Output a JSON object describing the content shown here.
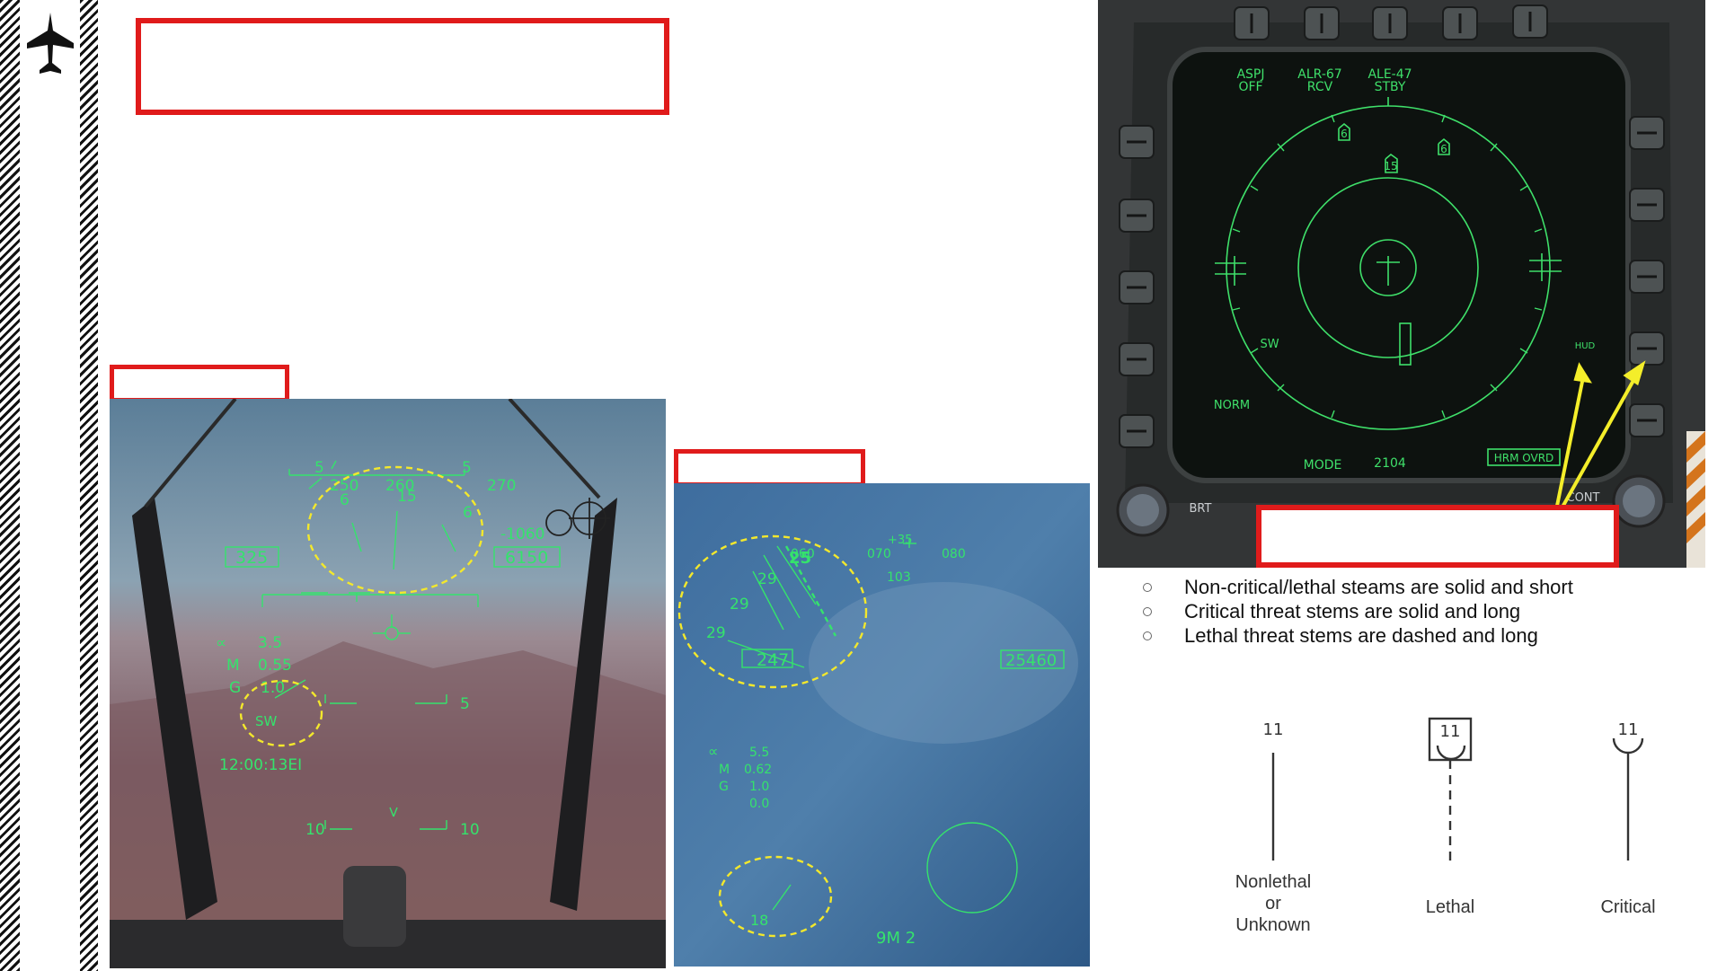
{
  "sidebar": {
    "logo_icon": "jet-silhouette-icon"
  },
  "hud1": {
    "heading_scale": [
      "5",
      "250",
      "260",
      "270",
      "5"
    ],
    "heading_value": "15",
    "threat_markers": [
      "6",
      "6"
    ],
    "airspeed": "325",
    "altitude": "6150",
    "vvi": "-1060",
    "alpha_label": "∝",
    "alpha": "3.5",
    "mach_label": "M",
    "mach": "0.55",
    "g_label": "G",
    "g": "1.0",
    "sw_symbol": "SW",
    "time": "12:00:13EI",
    "pitch_5_left": "5",
    "pitch_5_right": "5",
    "pitch_10_left": "10",
    "pitch_10_right": "10"
  },
  "hud2": {
    "heading_scale": [
      "060",
      "070",
      "080"
    ],
    "heading_value": "+35",
    "heading_sub": "103",
    "threat_values": [
      "29",
      "29",
      "29",
      "25"
    ],
    "airspeed": "247",
    "altitude": "25460",
    "alpha_label": "∝",
    "alpha": "5.5",
    "mach_label": "M",
    "mach": "0.62",
    "g_label": "G",
    "g": "1.0",
    "extra": "0.0",
    "lower_threat": "18",
    "weapon": "9M 2"
  },
  "ddi": {
    "top_labels": [
      {
        "line1": "ASPJ",
        "line2": "OFF"
      },
      {
        "line1": "ALR-67",
        "line2": "RCV"
      },
      {
        "line1": "ALE-47",
        "line2": "STBY"
      }
    ],
    "threats": [
      "6",
      "15",
      "6"
    ],
    "sw": "SW",
    "norm": "NORM",
    "hud": "HUD",
    "mode": "MODE",
    "mode_value": "2104",
    "hrm_ovrd": "HRM OVRD",
    "brt": "BRT",
    "cont": "CONT"
  },
  "bullets": [
    "Non-critical/lethal steams are solid and short",
    "Critical threat stems are solid and long",
    "Lethal threat stems are dashed and long"
  ],
  "symbols": [
    {
      "number": "11",
      "label_lines": [
        "Nonlethal",
        "or",
        "Unknown"
      ]
    },
    {
      "number": "11",
      "label_lines": [
        "Lethal"
      ]
    },
    {
      "number": "11",
      "label_lines": [
        "Critical"
      ]
    }
  ]
}
